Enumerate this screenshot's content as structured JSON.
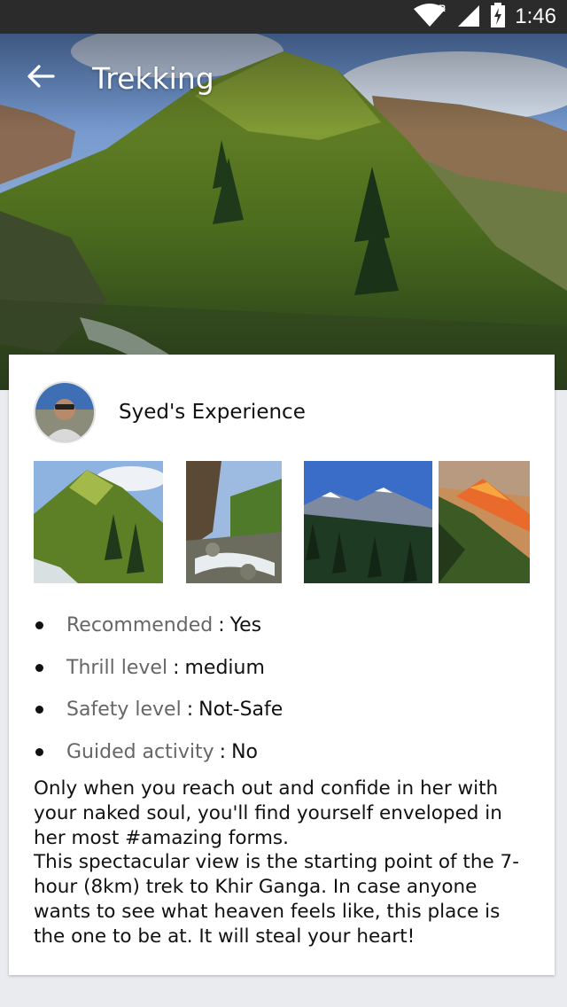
{
  "status_bar": {
    "time": "1:46",
    "icons": [
      "wifi-icon",
      "signal-icon",
      "battery-charging-icon"
    ],
    "roaming_indicator": "R"
  },
  "app_bar": {
    "title": "Trekking",
    "back_icon": "arrow-left-icon"
  },
  "experience": {
    "author_name": "Syed's Experience",
    "photos": [
      {
        "subject": "green mountain with river"
      },
      {
        "subject": "rocky stream through forest"
      },
      {
        "subject": "snowy peaks above pine forest"
      },
      {
        "subject": "mountain at sunset"
      }
    ],
    "facts": [
      {
        "label": "Recommended",
        "separator": ":",
        "value": "Yes"
      },
      {
        "label": "Thrill level",
        "separator": ":",
        "value": "medium"
      },
      {
        "label": "Safety level",
        "separator": ":",
        "value": "Not-Safe"
      },
      {
        "label": "Guided activity",
        "separator": ":",
        "value": "No"
      }
    ],
    "description": "Only when you reach out and confide in her with your naked soul, you'll find yourself enveloped in her most #amazing forms.\nThis spectacular view is the starting point of the 7-hour (8km) trek to Khir Ganga. In case anyone wants to see what heaven feels like, this place is the one to be at. It will steal your heart!"
  }
}
